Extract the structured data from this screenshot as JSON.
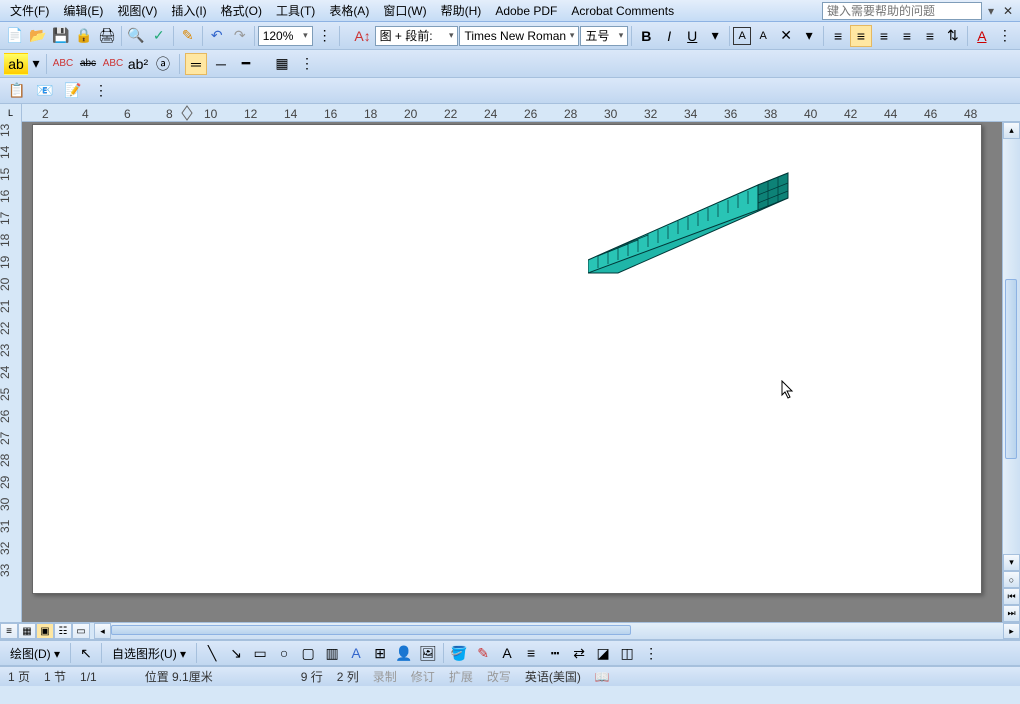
{
  "menu": {
    "file": "文件(F)",
    "edit": "编辑(E)",
    "view": "视图(V)",
    "insert": "插入(I)",
    "format": "格式(O)",
    "tools": "工具(T)",
    "table": "表格(A)",
    "window": "窗口(W)",
    "help": "帮助(H)",
    "adobe": "Adobe PDF",
    "acrobat": "Acrobat Comments"
  },
  "help_placeholder": "键入需要帮助的问题",
  "zoom": "120%",
  "style": "图 + 段前:",
  "font": "Times New Roman",
  "fontsize": "五号",
  "bold": "B",
  "italic": "I",
  "underline_label": "U",
  "ruler_marks": [
    "2",
    "4",
    "6",
    "8",
    "10",
    "12",
    "14",
    "16",
    "18",
    "20",
    "22",
    "24",
    "26",
    "28",
    "30",
    "32",
    "34",
    "36",
    "40",
    "42",
    "44",
    "46",
    "48"
  ],
  "vruler_marks": [
    "13",
    "14",
    "15",
    "16",
    "17",
    "18",
    "19",
    "20",
    "21",
    "22",
    "23",
    "24",
    "25",
    "26",
    "27",
    "28",
    "29",
    "30",
    "31",
    "32",
    "33"
  ],
  "draw": {
    "label": "绘图(D)",
    "autoshape": "自选图形(U)"
  },
  "status": {
    "page": "1 页",
    "section": "1 节",
    "pages": "1/1",
    "pos": "位置 9.1厘米",
    "line": "9 行",
    "col": "2 列",
    "rec": "录制",
    "rev": "修订",
    "ext": "扩展",
    "ovr": "改写",
    "lang": "英语(美国)"
  }
}
